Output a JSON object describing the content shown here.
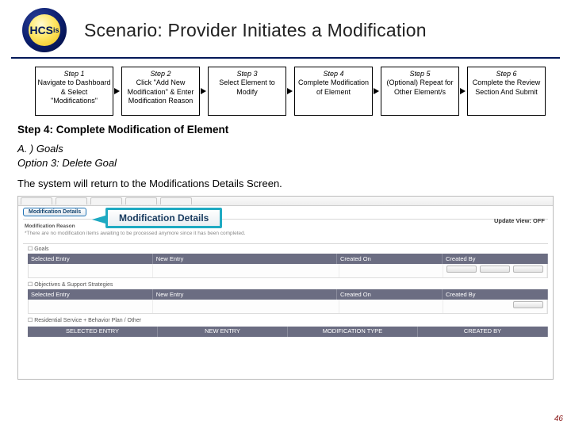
{
  "header": {
    "title": "Scenario: Provider Initiates a Modification",
    "logo_text": "HCSis"
  },
  "flow": [
    {
      "title": "Step 1",
      "text": "Navigate to Dashboard & Select \"Modifications\""
    },
    {
      "title": "Step 2",
      "text": "Click \"Add New Modification\" & Enter Modification Reason"
    },
    {
      "title": "Step 3",
      "text": "Select Element to Modify"
    },
    {
      "title": "Step 4",
      "text": "Complete Modification of Element"
    },
    {
      "title": "Step 5",
      "text": "(Optional) Repeat for Other Element/s"
    },
    {
      "title": "Step 6",
      "text": "Complete the Review Section And Submit"
    }
  ],
  "body": {
    "step_heading": "Step 4: Complete Modification of Element",
    "sub_a": "A. ) Goals",
    "sub_opt": "Option 3: Delete Goal",
    "desc": "The system will return to the Modifications Details Screen."
  },
  "screenshot": {
    "selected_tab": "Modification Details",
    "callout": "Modification Details",
    "update_view": "Update View: OFF",
    "section_label": "Modification Reason",
    "note": "*There are no modification items awaiting to be processed anymore since it has been completed.",
    "chk_goals": "☐ Goals",
    "chk_objectives": "☐ Objectives & Support Strategies",
    "chk_residential": "☐ Residential Service + Behavior Plan / Other",
    "grid_headers": {
      "c1": "Selected Entry",
      "c2": "New Entry",
      "c3": "Created On",
      "c4": "Created By"
    },
    "bottom": {
      "b1": "SELECTED ENTRY",
      "b2": "NEW ENTRY",
      "b3": "MODIFICATION TYPE",
      "b4": "CREATED BY"
    }
  },
  "page_number": "46"
}
